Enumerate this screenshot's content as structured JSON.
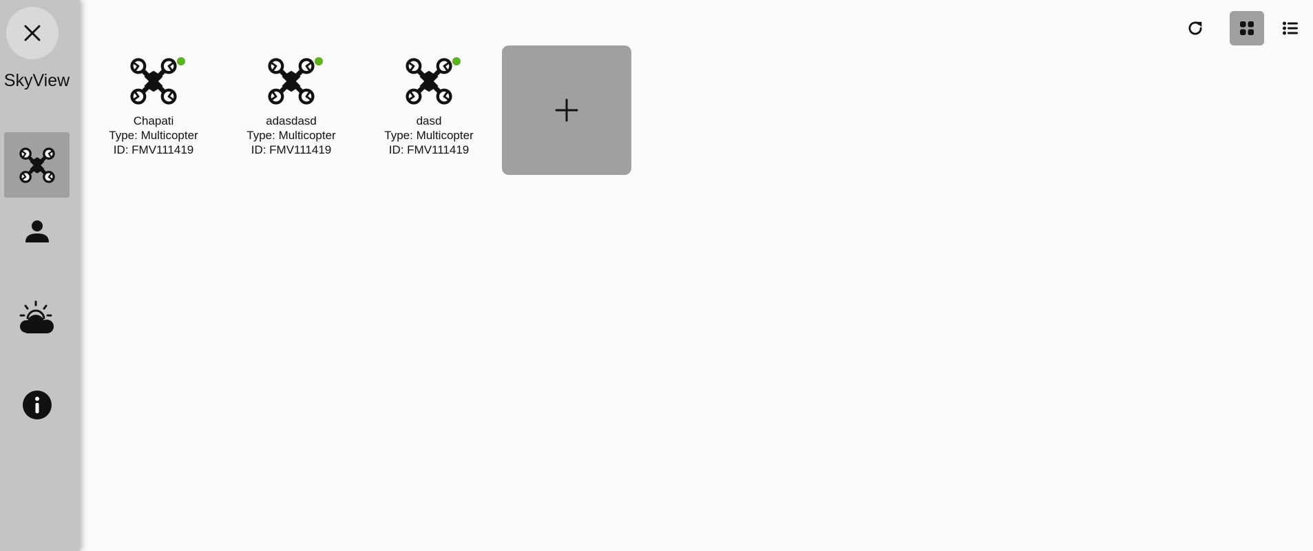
{
  "app": {
    "title": "SkyView"
  },
  "sidebar": {
    "close_icon": "close-icon",
    "items": [
      {
        "id": "drones",
        "icon": "drone-icon",
        "active": true
      },
      {
        "id": "users",
        "icon": "person-icon",
        "active": false
      },
      {
        "id": "weather",
        "icon": "weather-icon",
        "active": false
      },
      {
        "id": "info",
        "icon": "info-icon",
        "active": false
      }
    ]
  },
  "toolbar": {
    "refresh_icon": "refresh-icon",
    "grid_view_icon": "grid-view-icon",
    "list_view_icon": "list-view-icon",
    "active_view": "grid"
  },
  "drones": [
    {
      "name": "Chapati",
      "type": "Type: Multicopter",
      "id": "ID: FMV111419",
      "status": "online"
    },
    {
      "name": "adasdasd",
      "type": "Type: Multicopter",
      "id": "ID: FMV111419",
      "status": "online"
    },
    {
      "name": "dasd",
      "type": "Type: Multicopter",
      "id": "ID: FMV111419",
      "status": "online"
    }
  ],
  "add_button": {
    "icon": "plus-icon"
  },
  "colors": {
    "sidebar_bg": "#c4c4c4",
    "active_bg": "#a0a0a0",
    "status_online": "#5cb41a",
    "page_bg": "#fafafa"
  }
}
